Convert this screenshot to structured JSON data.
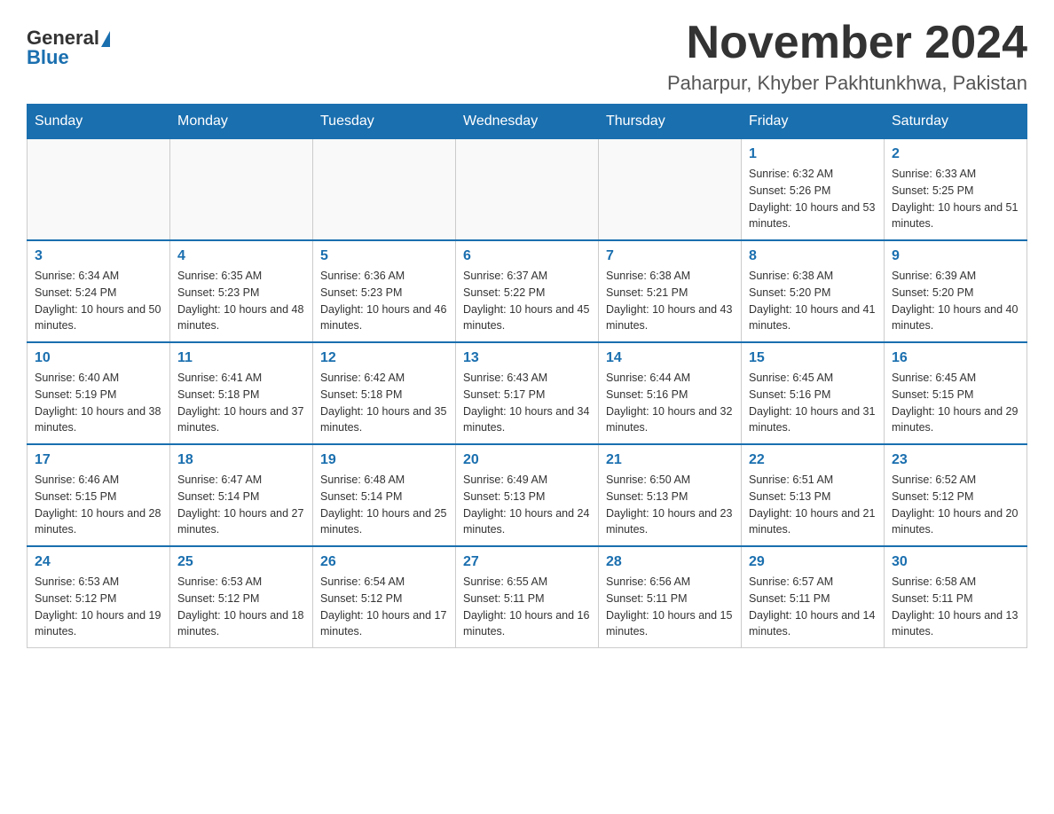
{
  "header": {
    "logo": {
      "general": "General",
      "blue": "Blue"
    },
    "title": "November 2024",
    "location": "Paharpur, Khyber Pakhtunkhwa, Pakistan"
  },
  "calendar": {
    "weekdays": [
      "Sunday",
      "Monday",
      "Tuesday",
      "Wednesday",
      "Thursday",
      "Friday",
      "Saturday"
    ],
    "weeks": [
      [
        {
          "day": "",
          "sunrise": "",
          "sunset": "",
          "daylight": ""
        },
        {
          "day": "",
          "sunrise": "",
          "sunset": "",
          "daylight": ""
        },
        {
          "day": "",
          "sunrise": "",
          "sunset": "",
          "daylight": ""
        },
        {
          "day": "",
          "sunrise": "",
          "sunset": "",
          "daylight": ""
        },
        {
          "day": "",
          "sunrise": "",
          "sunset": "",
          "daylight": ""
        },
        {
          "day": "1",
          "sunrise": "Sunrise: 6:32 AM",
          "sunset": "Sunset: 5:26 PM",
          "daylight": "Daylight: 10 hours and 53 minutes."
        },
        {
          "day": "2",
          "sunrise": "Sunrise: 6:33 AM",
          "sunset": "Sunset: 5:25 PM",
          "daylight": "Daylight: 10 hours and 51 minutes."
        }
      ],
      [
        {
          "day": "3",
          "sunrise": "Sunrise: 6:34 AM",
          "sunset": "Sunset: 5:24 PM",
          "daylight": "Daylight: 10 hours and 50 minutes."
        },
        {
          "day": "4",
          "sunrise": "Sunrise: 6:35 AM",
          "sunset": "Sunset: 5:23 PM",
          "daylight": "Daylight: 10 hours and 48 minutes."
        },
        {
          "day": "5",
          "sunrise": "Sunrise: 6:36 AM",
          "sunset": "Sunset: 5:23 PM",
          "daylight": "Daylight: 10 hours and 46 minutes."
        },
        {
          "day": "6",
          "sunrise": "Sunrise: 6:37 AM",
          "sunset": "Sunset: 5:22 PM",
          "daylight": "Daylight: 10 hours and 45 minutes."
        },
        {
          "day": "7",
          "sunrise": "Sunrise: 6:38 AM",
          "sunset": "Sunset: 5:21 PM",
          "daylight": "Daylight: 10 hours and 43 minutes."
        },
        {
          "day": "8",
          "sunrise": "Sunrise: 6:38 AM",
          "sunset": "Sunset: 5:20 PM",
          "daylight": "Daylight: 10 hours and 41 minutes."
        },
        {
          "day": "9",
          "sunrise": "Sunrise: 6:39 AM",
          "sunset": "Sunset: 5:20 PM",
          "daylight": "Daylight: 10 hours and 40 minutes."
        }
      ],
      [
        {
          "day": "10",
          "sunrise": "Sunrise: 6:40 AM",
          "sunset": "Sunset: 5:19 PM",
          "daylight": "Daylight: 10 hours and 38 minutes."
        },
        {
          "day": "11",
          "sunrise": "Sunrise: 6:41 AM",
          "sunset": "Sunset: 5:18 PM",
          "daylight": "Daylight: 10 hours and 37 minutes."
        },
        {
          "day": "12",
          "sunrise": "Sunrise: 6:42 AM",
          "sunset": "Sunset: 5:18 PM",
          "daylight": "Daylight: 10 hours and 35 minutes."
        },
        {
          "day": "13",
          "sunrise": "Sunrise: 6:43 AM",
          "sunset": "Sunset: 5:17 PM",
          "daylight": "Daylight: 10 hours and 34 minutes."
        },
        {
          "day": "14",
          "sunrise": "Sunrise: 6:44 AM",
          "sunset": "Sunset: 5:16 PM",
          "daylight": "Daylight: 10 hours and 32 minutes."
        },
        {
          "day": "15",
          "sunrise": "Sunrise: 6:45 AM",
          "sunset": "Sunset: 5:16 PM",
          "daylight": "Daylight: 10 hours and 31 minutes."
        },
        {
          "day": "16",
          "sunrise": "Sunrise: 6:45 AM",
          "sunset": "Sunset: 5:15 PM",
          "daylight": "Daylight: 10 hours and 29 minutes."
        }
      ],
      [
        {
          "day": "17",
          "sunrise": "Sunrise: 6:46 AM",
          "sunset": "Sunset: 5:15 PM",
          "daylight": "Daylight: 10 hours and 28 minutes."
        },
        {
          "day": "18",
          "sunrise": "Sunrise: 6:47 AM",
          "sunset": "Sunset: 5:14 PM",
          "daylight": "Daylight: 10 hours and 27 minutes."
        },
        {
          "day": "19",
          "sunrise": "Sunrise: 6:48 AM",
          "sunset": "Sunset: 5:14 PM",
          "daylight": "Daylight: 10 hours and 25 minutes."
        },
        {
          "day": "20",
          "sunrise": "Sunrise: 6:49 AM",
          "sunset": "Sunset: 5:13 PM",
          "daylight": "Daylight: 10 hours and 24 minutes."
        },
        {
          "day": "21",
          "sunrise": "Sunrise: 6:50 AM",
          "sunset": "Sunset: 5:13 PM",
          "daylight": "Daylight: 10 hours and 23 minutes."
        },
        {
          "day": "22",
          "sunrise": "Sunrise: 6:51 AM",
          "sunset": "Sunset: 5:13 PM",
          "daylight": "Daylight: 10 hours and 21 minutes."
        },
        {
          "day": "23",
          "sunrise": "Sunrise: 6:52 AM",
          "sunset": "Sunset: 5:12 PM",
          "daylight": "Daylight: 10 hours and 20 minutes."
        }
      ],
      [
        {
          "day": "24",
          "sunrise": "Sunrise: 6:53 AM",
          "sunset": "Sunset: 5:12 PM",
          "daylight": "Daylight: 10 hours and 19 minutes."
        },
        {
          "day": "25",
          "sunrise": "Sunrise: 6:53 AM",
          "sunset": "Sunset: 5:12 PM",
          "daylight": "Daylight: 10 hours and 18 minutes."
        },
        {
          "day": "26",
          "sunrise": "Sunrise: 6:54 AM",
          "sunset": "Sunset: 5:12 PM",
          "daylight": "Daylight: 10 hours and 17 minutes."
        },
        {
          "day": "27",
          "sunrise": "Sunrise: 6:55 AM",
          "sunset": "Sunset: 5:11 PM",
          "daylight": "Daylight: 10 hours and 16 minutes."
        },
        {
          "day": "28",
          "sunrise": "Sunrise: 6:56 AM",
          "sunset": "Sunset: 5:11 PM",
          "daylight": "Daylight: 10 hours and 15 minutes."
        },
        {
          "day": "29",
          "sunrise": "Sunrise: 6:57 AM",
          "sunset": "Sunset: 5:11 PM",
          "daylight": "Daylight: 10 hours and 14 minutes."
        },
        {
          "day": "30",
          "sunrise": "Sunrise: 6:58 AM",
          "sunset": "Sunset: 5:11 PM",
          "daylight": "Daylight: 10 hours and 13 minutes."
        }
      ]
    ]
  }
}
